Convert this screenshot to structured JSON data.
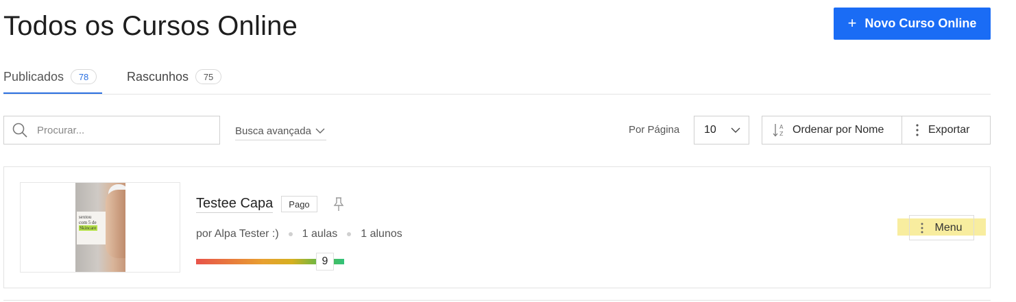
{
  "header": {
    "title": "Todos os Cursos Online",
    "new_button_label": "Novo Curso Online",
    "new_button_icon": "plus-icon",
    "accent_color": "#1a6cf5"
  },
  "tabs": [
    {
      "label": "Publicados",
      "count": "78",
      "active": true
    },
    {
      "label": "Rascunhos",
      "count": "75",
      "active": false
    }
  ],
  "toolbar": {
    "search_placeholder": "Procurar...",
    "advanced_search_label": "Busca avançada",
    "per_page_label": "Por Página",
    "per_page_value": "10",
    "sort_label": "Ordenar por Nome",
    "export_label": "Exportar"
  },
  "courses": [
    {
      "title": "Testee Capa",
      "badge": "Pago",
      "author": "por Alpa Tester :)",
      "lessons": "1 aulas",
      "students": "1 alunos",
      "progress_value": "9",
      "menu_label": "Menu",
      "thumbnail": {
        "line1": "sextou",
        "line2": "com 5 de",
        "highlight": "Skincare"
      }
    }
  ]
}
